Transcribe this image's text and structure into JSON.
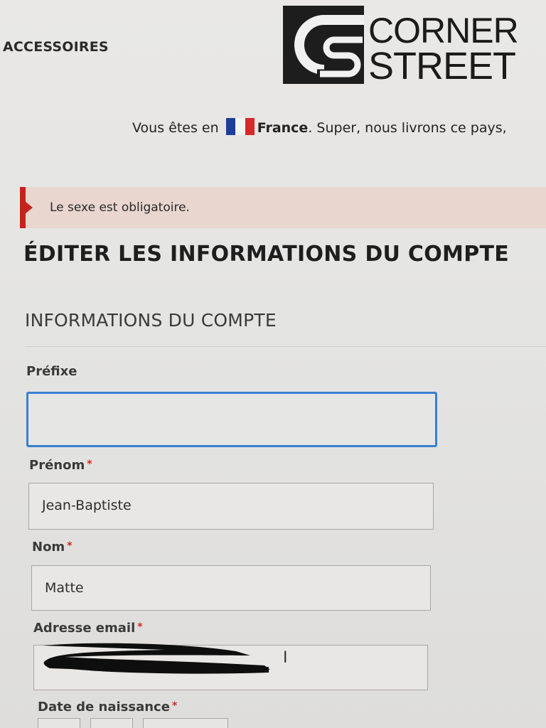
{
  "header": {
    "nav_link": "ACCESSOIRES",
    "logo": {
      "line1": "CORNER",
      "line2": "STREET",
      "mark": "CS"
    },
    "country_bar": {
      "prefix": "Vous êtes en",
      "country": "France",
      "suffix": ". Super, nous livrons ce pays,",
      "flag_colors": [
        "#1d3f95",
        "#ffffff",
        "#d42a2a"
      ]
    }
  },
  "error": {
    "message": "Le sexe est obligatoire.",
    "accent_color": "#c4241d"
  },
  "page_title": "ÉDITER LES INFORMATIONS DU COMPTE",
  "section_title": "INFORMATIONS DU COMPTE",
  "form": {
    "prefix": {
      "label": "Préfixe",
      "value": ""
    },
    "first_name": {
      "label": "Prénom",
      "required_mark": "*",
      "value": "Jean-Baptiste"
    },
    "last_name": {
      "label": "Nom",
      "required_mark": "*",
      "value": "Matte"
    },
    "email": {
      "label": "Adresse email",
      "required_mark": "*",
      "value": ""
    },
    "birth_date": {
      "label": "Date de naissance",
      "required_mark": "*"
    }
  },
  "colors": {
    "focus_border": "#3b7fd1",
    "required": "#d0281f"
  }
}
